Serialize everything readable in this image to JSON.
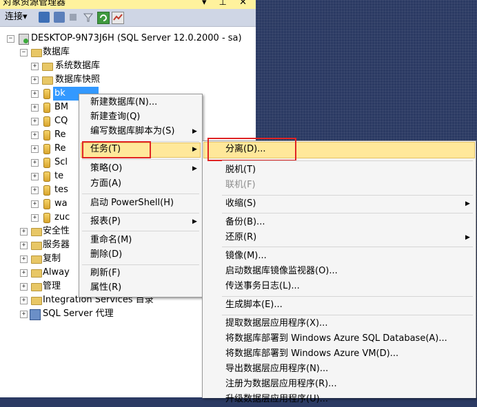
{
  "panel": {
    "title": "对象资源管理器",
    "controls": "▾ ⊥ ✕"
  },
  "toolbar": {
    "connect_label": "连接▾"
  },
  "tree": {
    "server": "DESKTOP-9N73J6H (SQL Server 12.0.2000 - sa)",
    "databases": "数据库",
    "system_db": "系统数据库",
    "snapshots": "数据库快照",
    "db_items": [
      "bk",
      "BM",
      "CQ",
      "Re",
      "Re",
      "Scl",
      "te",
      "tes",
      "wa",
      "zuc"
    ],
    "security": "安全性",
    "server_objects": "服务器",
    "replication": "复制",
    "always_on": "Alway",
    "management": "管理",
    "integration": "Integration Services 目录",
    "agent": "SQL Server 代理"
  },
  "context_menu": {
    "new_db": "新建数据库(N)...",
    "new_query": "新建查询(Q)",
    "script_db": "编写数据库脚本为(S)",
    "tasks": "任务(T)",
    "policies": "策略(O)",
    "facets": "方面(A)",
    "powershell": "启动 PowerShell(H)",
    "reports": "报表(P)",
    "rename": "重命名(M)",
    "delete": "删除(D)",
    "refresh": "刷新(F)",
    "properties": "属性(R)"
  },
  "tasks_menu": {
    "detach": "分离(D)...",
    "offline": "脱机(T)",
    "online": "联机(F)",
    "shrink": "收缩(S)",
    "backup": "备份(B)...",
    "restore": "还原(R)",
    "mirror": "镜像(M)...",
    "mirror_monitor": "启动数据库镜像监视器(O)...",
    "ship_logs": "传送事务日志(L)...",
    "gen_scripts": "生成脚本(E)...",
    "extract_dac": "提取数据层应用程序(X)...",
    "deploy_azure_sql": "将数据库部署到 Windows Azure SQL Database(A)...",
    "deploy_azure_vm": "将数据库部署到 Windows Azure VM(D)...",
    "export_dac": "导出数据层应用程序(N)...",
    "register_dac": "注册为数据层应用程序(R)...",
    "upgrade_dac": "升级数据层应用程序(U)..."
  },
  "colors": {
    "highlight": "#ffe89a",
    "annotation_red": "#e02424",
    "selection": "#3399ff"
  }
}
